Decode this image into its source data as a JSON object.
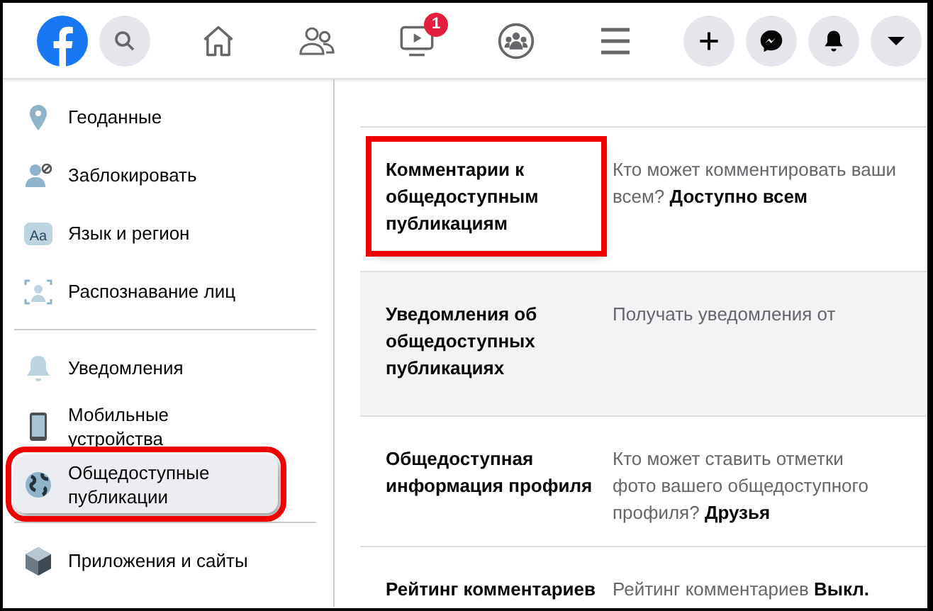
{
  "header": {
    "nav": [
      {
        "kind": "home",
        "selected": false
      },
      {
        "kind": "friends",
        "selected": false
      },
      {
        "kind": "watch",
        "selected": false,
        "badge": "1"
      },
      {
        "kind": "groups",
        "selected": false
      },
      {
        "kind": "menu",
        "selected": false
      }
    ],
    "actions": [
      {
        "kind": "plus"
      },
      {
        "kind": "messenger"
      },
      {
        "kind": "bell"
      },
      {
        "kind": "caret"
      }
    ]
  },
  "sidebar": {
    "groups": [
      {
        "items": [
          {
            "kind": "pin",
            "label": "Геоданные",
            "selected": false,
            "highlighted": false
          },
          {
            "kind": "block",
            "label": "Заблокировать",
            "selected": false,
            "highlighted": false
          },
          {
            "kind": "language",
            "icon_text": "Aa",
            "label": "Язык и регион",
            "selected": false,
            "highlighted": false
          },
          {
            "kind": "face",
            "label": "Распознавание лиц",
            "selected": false,
            "highlighted": false
          }
        ]
      },
      {
        "items": [
          {
            "kind": "bell",
            "label": "Уведомления",
            "selected": false,
            "highlighted": false
          },
          {
            "kind": "phone",
            "label": "Мобильные устройства",
            "selected": false,
            "highlighted": false
          },
          {
            "kind": "globe",
            "label": "Общедоступные публикации",
            "selected": true,
            "highlighted": true
          }
        ]
      },
      {
        "items": [
          {
            "kind": "cube",
            "label": "Приложения и сайты",
            "selected": false,
            "highlighted": false
          }
        ]
      }
    ]
  },
  "settings": [
    {
      "title": "Комментарии к общедоступным публикациям",
      "description": [
        "Кто может комментировать ваши",
        "всем? **Доступно всем**"
      ],
      "hovered": false,
      "highlighted": true
    },
    {
      "title": "Уведомления об общедоступных публикациях",
      "description": [
        "Получать уведомления от"
      ],
      "hovered": true,
      "highlighted": false
    },
    {
      "title": "Общедоступная информация профиля",
      "description": [
        "Кто может ставить отметки",
        "фото вашего общедоступного",
        "профиля? **Друзья**"
      ],
      "hovered": false,
      "highlighted": false
    },
    {
      "title": "Рейтинг комментариев",
      "description": [
        "Рейтинг комментариев **Выкл.**"
      ],
      "hovered": false,
      "highlighted": false
    }
  ]
}
